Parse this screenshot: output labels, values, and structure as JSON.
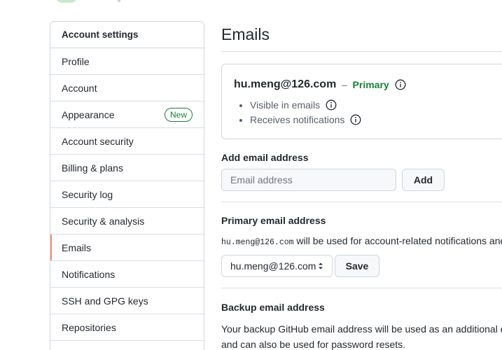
{
  "sidebar": {
    "header": "Account settings",
    "items": [
      {
        "label": "Profile"
      },
      {
        "label": "Account"
      },
      {
        "label": "Appearance",
        "badge": "New"
      },
      {
        "label": "Account security"
      },
      {
        "label": "Billing & plans"
      },
      {
        "label": "Security log"
      },
      {
        "label": "Security & analysis"
      },
      {
        "label": "Emails",
        "selected": true
      },
      {
        "label": "Notifications"
      },
      {
        "label": "SSH and GPG keys"
      },
      {
        "label": "Repositories"
      }
    ]
  },
  "main": {
    "title": "Emails",
    "email_card": {
      "address": "hu.meng@126.com",
      "dash": "–",
      "primary_label": "Primary",
      "properties": [
        "Visible in emails",
        "Receives notifications"
      ]
    },
    "add_email": {
      "label": "Add email address",
      "placeholder": "Email address",
      "button": "Add"
    },
    "primary_email": {
      "label": "Primary email address",
      "desc_code": "hu.meng@126.com",
      "desc_text": " will be used for account-related notifications and",
      "selected_value": "hu.meng@126.com",
      "save_button": "Save"
    },
    "backup_email": {
      "label": "Backup email address",
      "desc_line1": "Your backup GitHub email address will be used as an additional d",
      "desc_line2": "and can also be used for password resets."
    }
  },
  "colors": {
    "primary_green": "#1a7f37",
    "selected_accent": "#fd8c73",
    "border": "#d0d7de"
  }
}
